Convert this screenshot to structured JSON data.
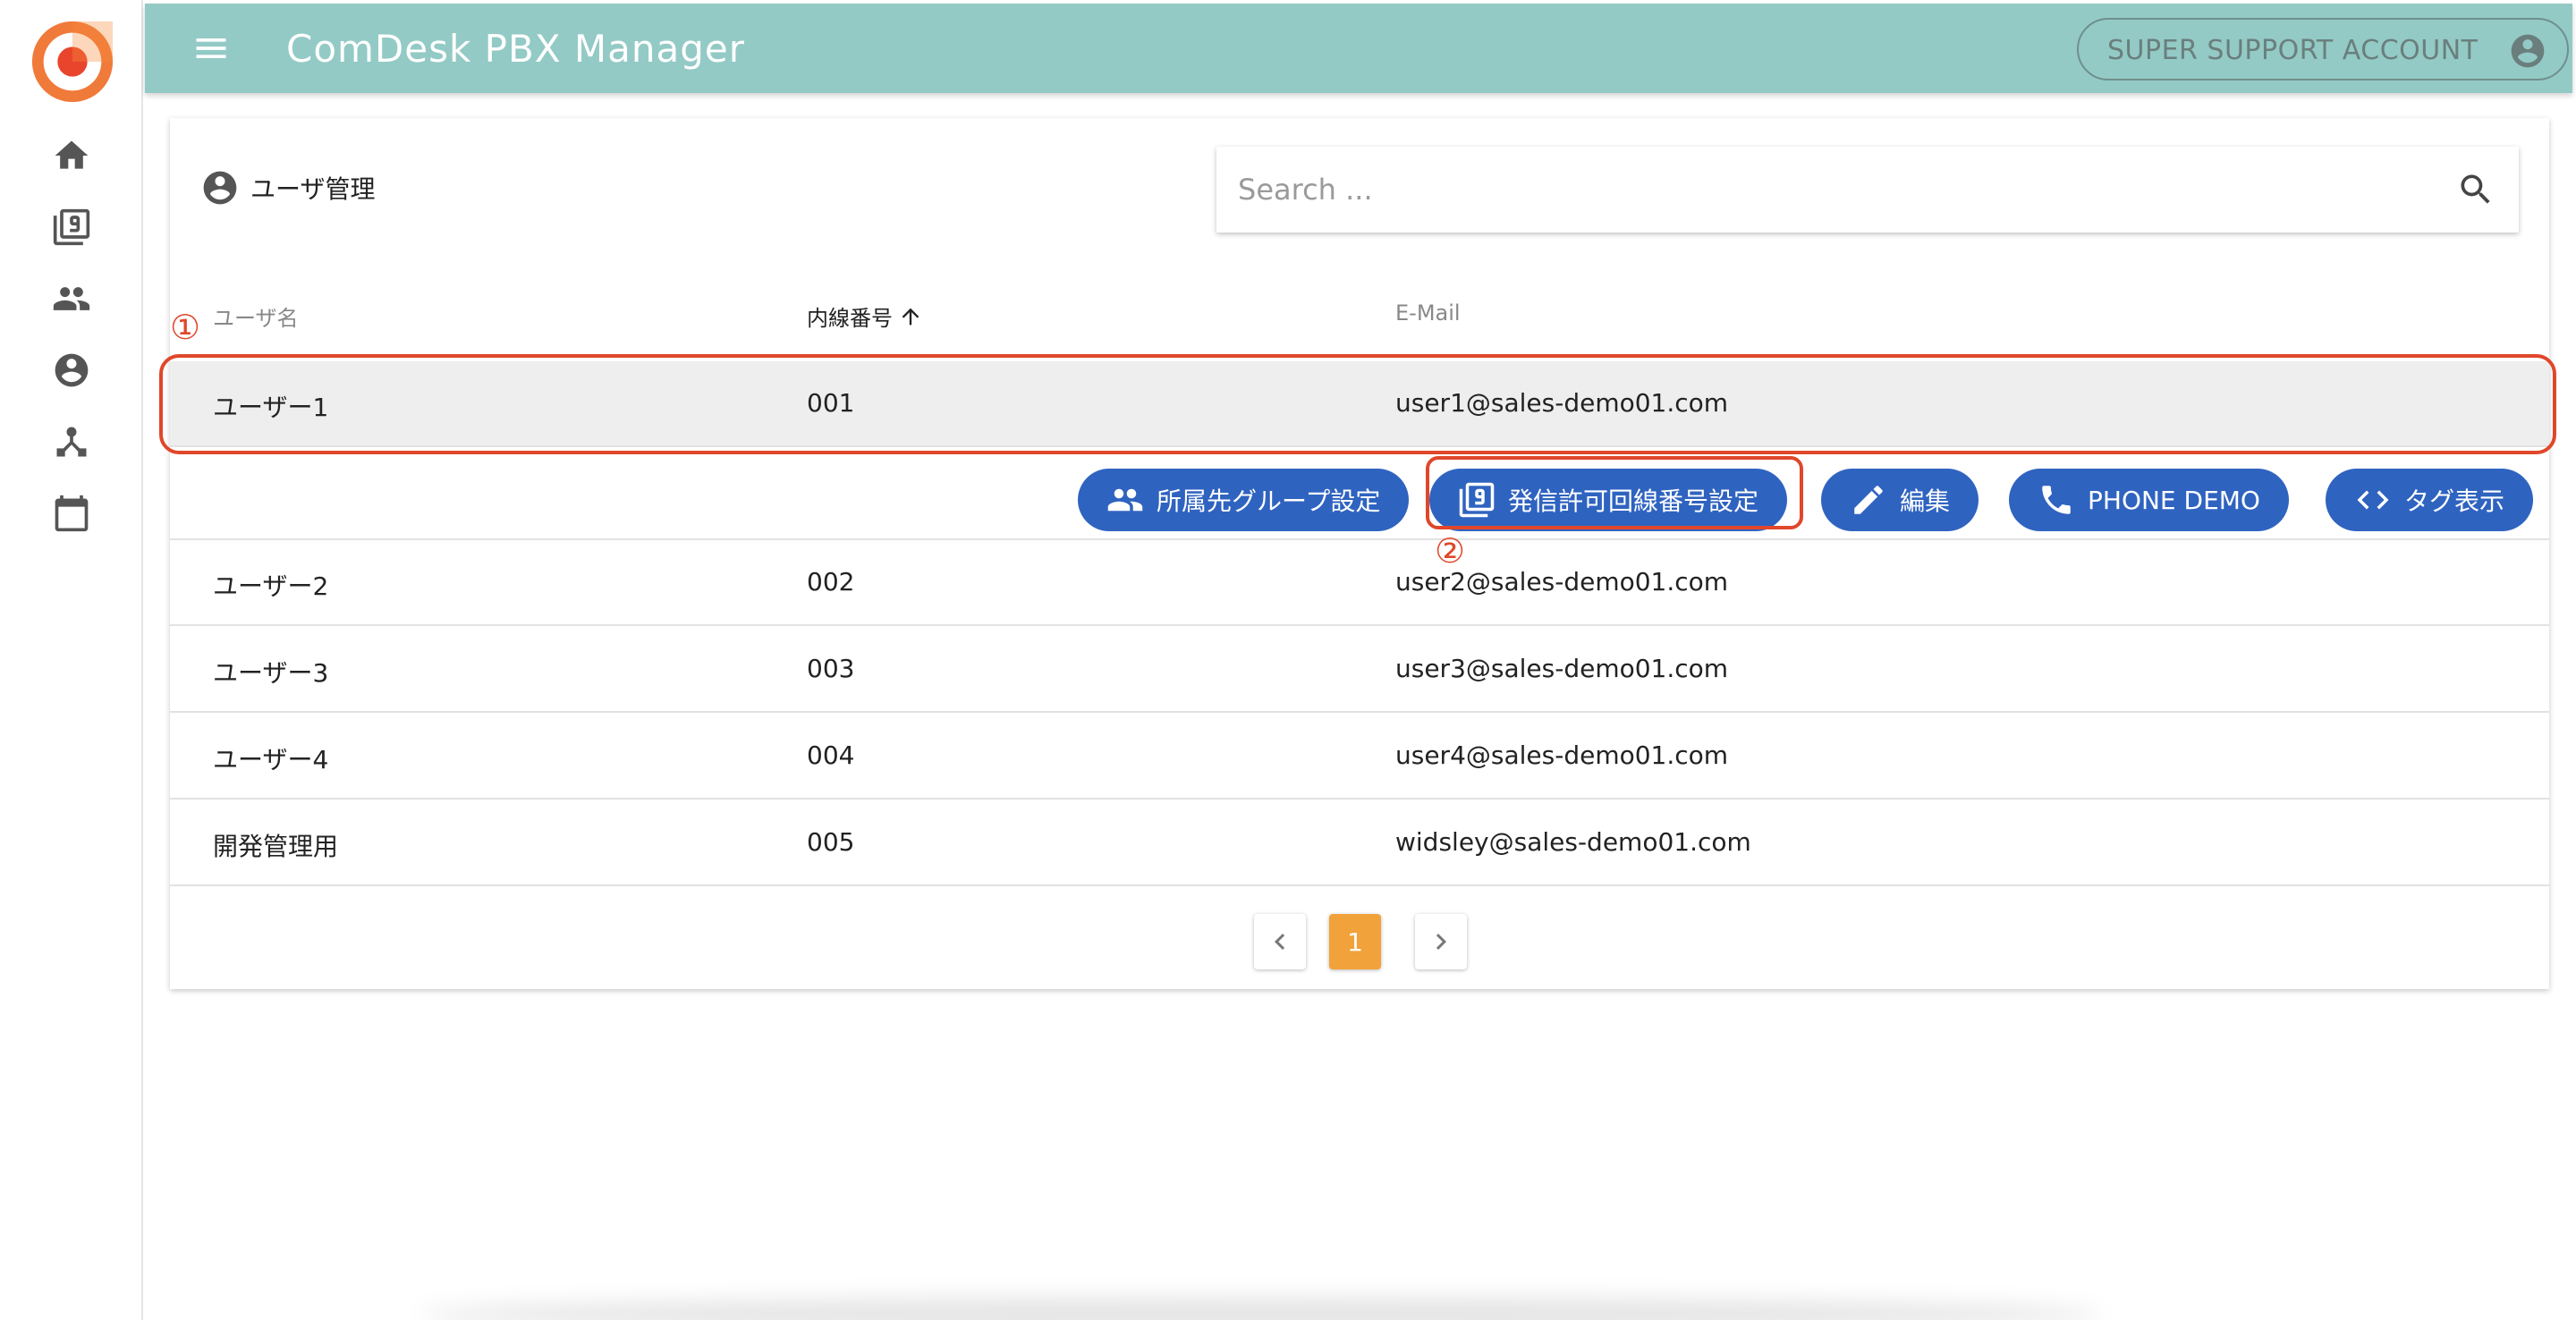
{
  "app": {
    "title": "ComDesk PBX Manager"
  },
  "account": {
    "label": "SUPER SUPPORT ACCOUNT"
  },
  "card": {
    "title": "ユーザ管理"
  },
  "search": {
    "placeholder": "Search ..."
  },
  "table": {
    "columns": [
      "ユーザ名",
      "内線番号",
      "E-Mail"
    ],
    "rows": [
      {
        "name": "ユーザー1",
        "ext": "001",
        "email": "user1@sales-demo01.com"
      },
      {
        "name": "ユーザー2",
        "ext": "002",
        "email": "user2@sales-demo01.com"
      },
      {
        "name": "ユーザー3",
        "ext": "003",
        "email": "user3@sales-demo01.com"
      },
      {
        "name": "ユーザー4",
        "ext": "004",
        "email": "user4@sales-demo01.com"
      },
      {
        "name": "開発管理用",
        "ext": "005",
        "email": "widsley@sales-demo01.com"
      }
    ]
  },
  "actions": {
    "group_setting": "所属先グループ設定",
    "outgoing_line_setting": "発信許可回線番号設定",
    "edit": "編集",
    "phone_demo": "PHONE DEMO",
    "tag_display": "タグ表示"
  },
  "pagination": {
    "current": "1"
  },
  "annotations": {
    "mark1": "①",
    "mark2": "②"
  },
  "colors": {
    "topbar": "#93cac5",
    "button": "#2f63c0",
    "page_active": "#f2a23a",
    "annotation": "#e0472b"
  }
}
